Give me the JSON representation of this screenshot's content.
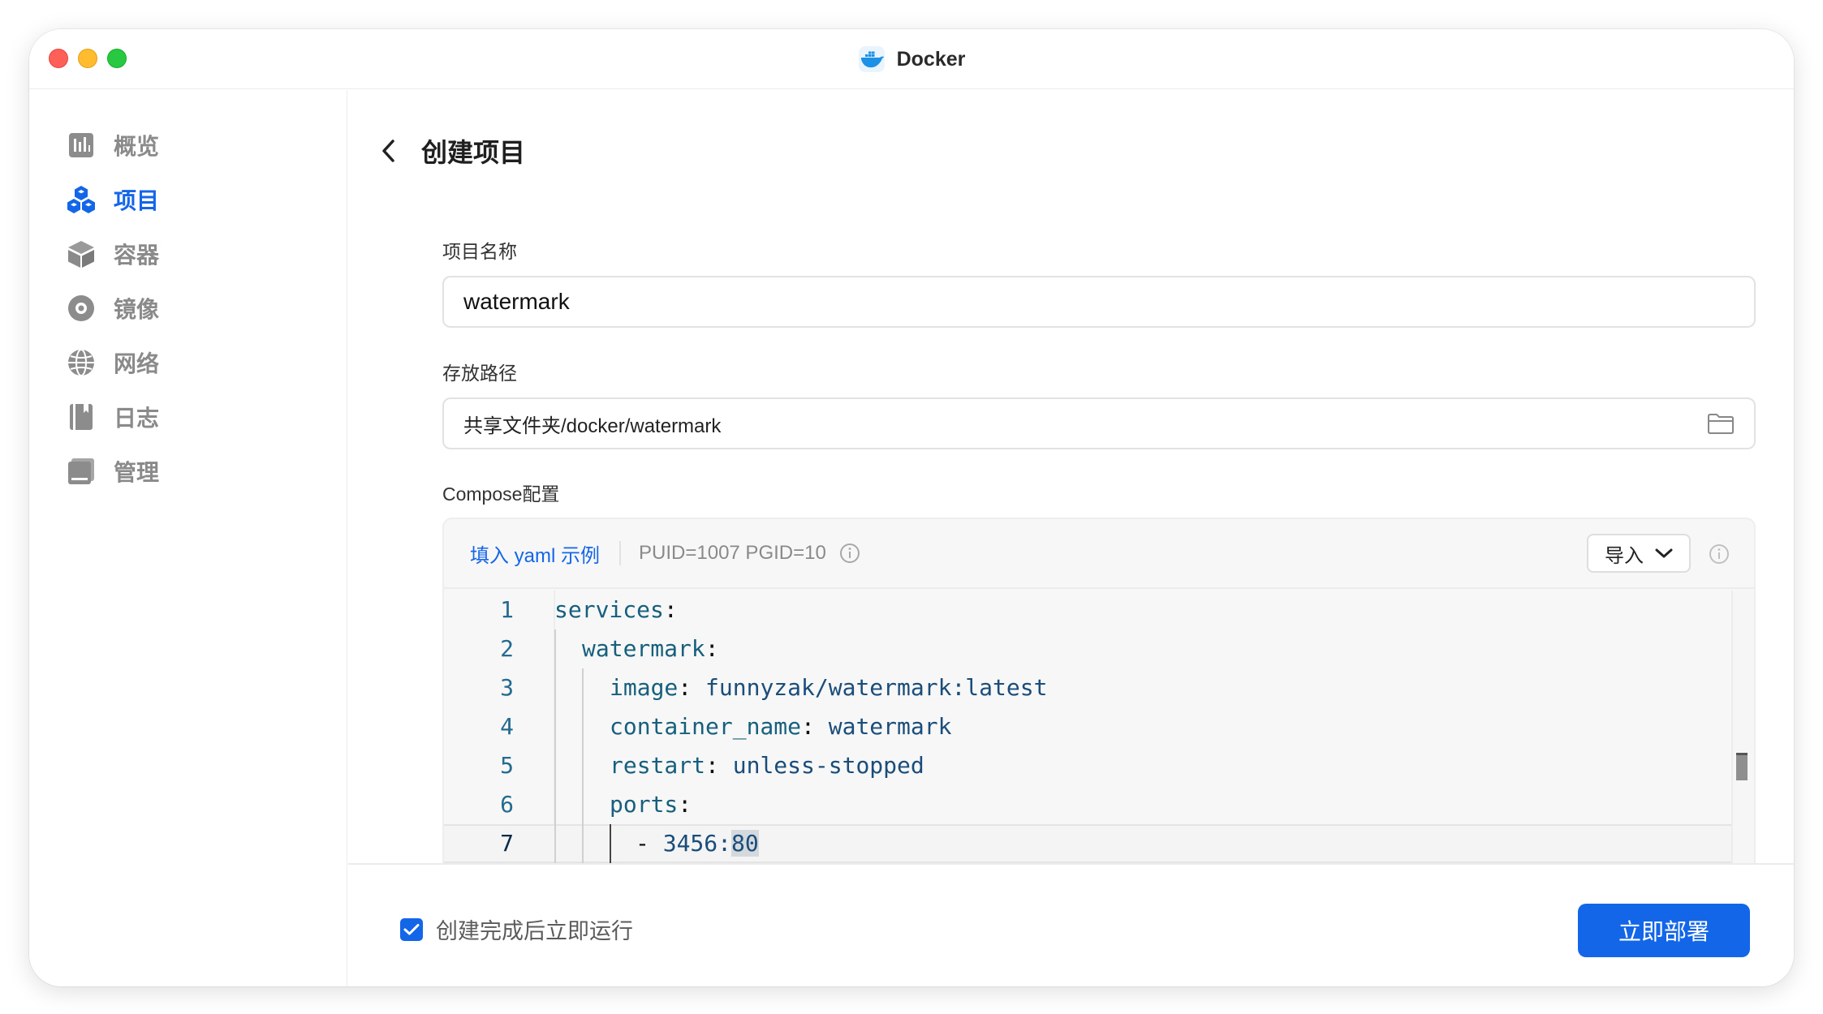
{
  "window": {
    "title": "Docker"
  },
  "sidebar": {
    "items": [
      {
        "label": "概览",
        "icon": "overview-icon",
        "active": false
      },
      {
        "label": "项目",
        "icon": "project-icon",
        "active": true
      },
      {
        "label": "容器",
        "icon": "container-icon",
        "active": false
      },
      {
        "label": "镜像",
        "icon": "image-icon",
        "active": false
      },
      {
        "label": "网络",
        "icon": "network-icon",
        "active": false
      },
      {
        "label": "日志",
        "icon": "log-icon",
        "active": false
      },
      {
        "label": "管理",
        "icon": "manage-icon",
        "active": false
      }
    ]
  },
  "header": {
    "title": "创建项目"
  },
  "form": {
    "name_label": "项目名称",
    "name_value": "watermark",
    "path_label": "存放路径",
    "path_value": "共享文件夹/docker/watermark",
    "compose_label": "Compose配置"
  },
  "compose": {
    "fill_example": "填入 yaml 示例",
    "puid_info": "PUID=1007 PGID=10",
    "import_label": "导入",
    "lines": [
      {
        "num": "1",
        "key": "services",
        "sep": ":",
        "value": ""
      },
      {
        "num": "2",
        "key": "watermark",
        "sep": ":",
        "value": ""
      },
      {
        "num": "3",
        "key": "image",
        "sep": ": ",
        "value": "funnyzak/watermark:latest"
      },
      {
        "num": "4",
        "key": "container_name",
        "sep": ": ",
        "value": "watermark"
      },
      {
        "num": "5",
        "key": "restart",
        "sep": ": ",
        "value": "unless-stopped"
      },
      {
        "num": "6",
        "key": "ports",
        "sep": ":",
        "value": ""
      },
      {
        "num": "7",
        "key": "- ",
        "sep": "3456:",
        "value": "80"
      }
    ]
  },
  "footer": {
    "run_after_create": "创建完成后立即运行",
    "run_after_create_checked": true,
    "deploy_button": "立即部署"
  },
  "colors": {
    "accent": "#1466e8",
    "code_key": "#17607d",
    "line_number": "#246a91"
  }
}
